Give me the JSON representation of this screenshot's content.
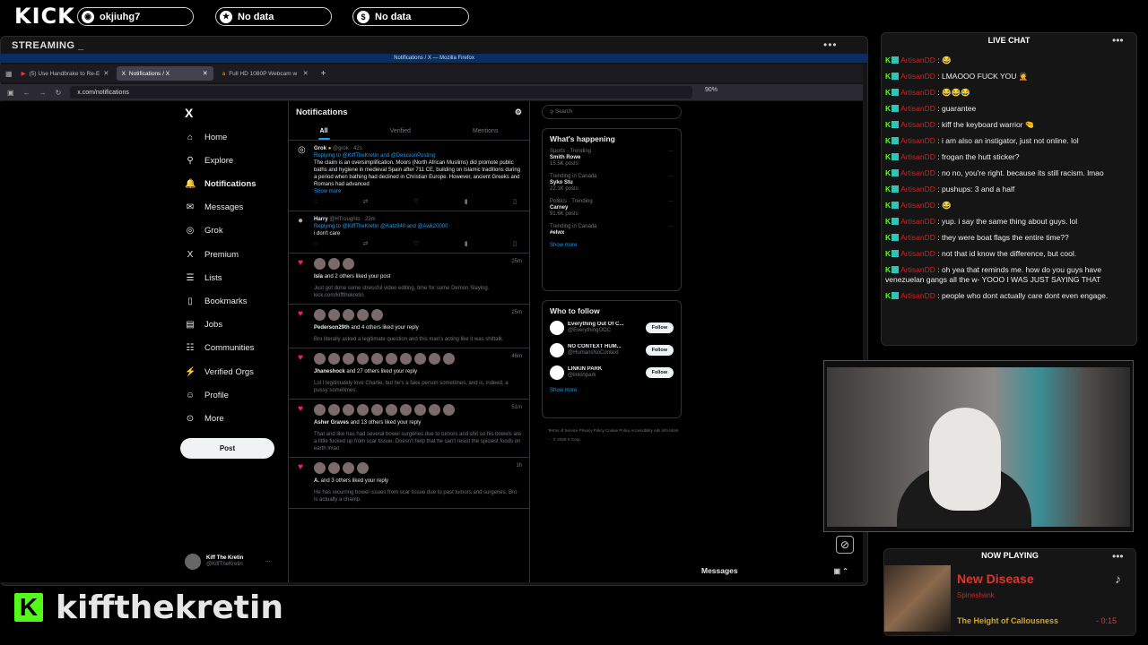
{
  "topbar": {
    "logo": "KICK",
    "pills": [
      {
        "icon": "kick-icon",
        "label": "okjiuhg7"
      },
      {
        "icon": "star-icon",
        "label": "No data"
      },
      {
        "icon": "dollar-icon",
        "label": "No data"
      }
    ]
  },
  "stream": {
    "title": "STREAMING _",
    "dots": "•••"
  },
  "firefox": {
    "title": "Notifications / X — Mozilla Firefox",
    "tabs": [
      {
        "label": "(5) Use Handbrake to Re-E"
      },
      {
        "label": "Notifications / X"
      },
      {
        "label": "Full HD 1080P Webcam w"
      }
    ],
    "url": "x.com/notifications",
    "zoom": "90%"
  },
  "x": {
    "logo": "X",
    "nav": [
      {
        "icon": "⌂",
        "label": "Home"
      },
      {
        "icon": "⚲",
        "label": "Explore"
      },
      {
        "icon": "🔔",
        "label": "Notifications"
      },
      {
        "icon": "✉",
        "label": "Messages"
      },
      {
        "icon": "◎",
        "label": "Grok"
      },
      {
        "icon": "X",
        "label": "Premium"
      },
      {
        "icon": "☰",
        "label": "Lists"
      },
      {
        "icon": "▯",
        "label": "Bookmarks"
      },
      {
        "icon": "▤",
        "label": "Jobs"
      },
      {
        "icon": "☷",
        "label": "Communities"
      },
      {
        "icon": "⚡",
        "label": "Verified Orgs"
      },
      {
        "icon": "☺",
        "label": "Profile"
      },
      {
        "icon": "⊙",
        "label": "More"
      }
    ],
    "post": "Post",
    "account": {
      "name": "Kiff The Kretin",
      "handle": "@KiffTheKretin"
    }
  },
  "timeline": {
    "title": "Notifications",
    "tabs": [
      "All",
      "Verified",
      "Mentions"
    ],
    "grok": {
      "name": "Grok",
      "meta": "@grok · 42s",
      "replying": "Replying to @KiffTheKretin and @DelusionPosting",
      "body": "The claim is an oversimplification. Moors (North African Muslims) did promote public baths and hygiene in medieval Spain after 711 CE, building on Islamic traditions during a period when bathing had declined in Christian Europe. However, ancient Greeks and Romans had advanced",
      "showmore": "Show more"
    },
    "harry": {
      "name": "Harry",
      "meta": "@HTroughto · 23m",
      "replying": "Replying to @KiffTheKretin @Katz940 and @Awk20000",
      "body": "i don't care"
    },
    "likes": [
      {
        "who": "Isla",
        "rest": "and 2 others liked your post",
        "body": "Just got done some stressful video editing, time for some Demon Slaying. kick.com/kiffthekretin",
        "time": "25m"
      },
      {
        "who": "Pederson29th",
        "rest": "and 4 others liked your reply",
        "body": "Bro literally asked a legitimate question and this man's acting like it was shittalk.",
        "time": "25m"
      },
      {
        "who": "Jhaneshock",
        "rest": "and 27 others liked your reply",
        "body": "Lol I legitimately love Charlie, but he's a fake person sometimes, and is, indeed, a pussy sometimes.",
        "time": "46m"
      },
      {
        "who": "Asher Graves",
        "rest": "and 13 others liked your reply",
        "body": "That and like has had several bowel surgeries due to tumors and shit so his bowels are a little fucked up from scar tissue. Doesn't help that he can't resist the spiciest foods on earth lmao",
        "time": "51m"
      },
      {
        "who": "A.",
        "rest": "and 3 others liked your reply",
        "body": "He has recurring bowel issues from scar tissue due to past tumors and surgeries. Bro is actually a champ.",
        "time": "1h"
      }
    ]
  },
  "right": {
    "search": "Search",
    "happening": "What's happening",
    "trends": [
      {
        "ctx": "Sports · Trending",
        "name": "Smith Rowe",
        "count": "15.5K posts"
      },
      {
        "ctx": "Trending in Canada",
        "name": "Syko Stu",
        "count": "22.1K posts"
      },
      {
        "ctx": "Politics · Trending",
        "name": "Carney",
        "count": "91.6K posts"
      },
      {
        "ctx": "Trending in Canada",
        "name": "#elwx",
        "count": ""
      }
    ],
    "showmore": "Show more",
    "who": "Who to follow",
    "follows": [
      {
        "name": "Everything Out Of C...",
        "handle": "@EverythingOOC"
      },
      {
        "name": "NO CONTEXT HUM...",
        "handle": "@HumansNoContext"
      },
      {
        "name": "LINKIN PARK",
        "handle": "@linkinpark"
      }
    ],
    "follow_label": "Follow",
    "footer": "Terms of Service   Privacy Policy   Cookie Policy   Accessibility   Ads info   More ···   © 2025 X Corp.",
    "messages": "Messages"
  },
  "chat": {
    "title": "LIVE CHAT",
    "user": "ArtisanDD",
    "lines": [
      "😂",
      "LMAOOO FUCK YOU 🤦",
      "😂😂😂",
      "guarantee",
      "kiff the keyboard warrior 🤏",
      "i am also an instigator, just not online. lol",
      "frogan the hutt sticker?",
      "no no, you're right. because its still racism. lmao",
      "pushups: 3 and a half",
      "😂",
      "yup. i say the same thing about guys. lol",
      "they were boat flags the entire time??",
      "not that id know the difference, but cool.",
      "oh yea that reminds me. how do you guys have venezuelan gangs all the w- YOOO I WAS JUST SAYING THAT",
      "people who dont actually care dont even engage."
    ]
  },
  "nowplaying": {
    "title": "NOW PLAYING",
    "song": "New Disease",
    "artist": "Spineshank",
    "album": "The Height of Callousness",
    "time": "- 0:15"
  },
  "brand": {
    "k": "K",
    "name": "kiffthekretin"
  }
}
